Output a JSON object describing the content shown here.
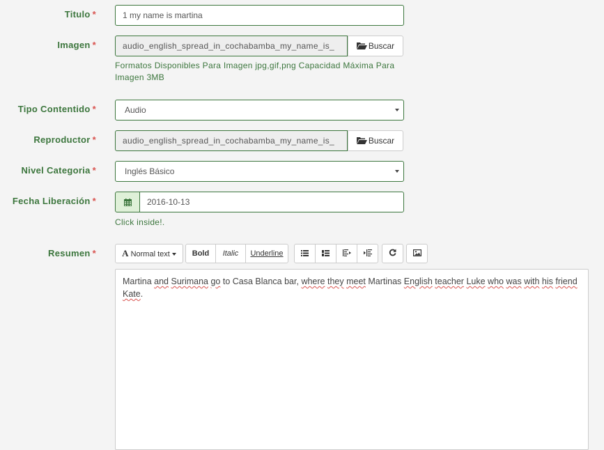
{
  "form": {
    "required_mark": "*",
    "titulo": {
      "label": "Titulo",
      "value": "1 my name is martina"
    },
    "imagen": {
      "label": "Imagen",
      "value": "audio_english_spread_in_cochabamba_my_name_is_",
      "button": "Buscar",
      "help_line1": "Formatos Disponibles Para Imagen jpg,gif,png Capacidad Máxima Para",
      "help_line2": "Imagen 3MB"
    },
    "tipo_contenido": {
      "label": "Tipo Contentido",
      "value": "Audio"
    },
    "reproductor": {
      "label": "Reproductor",
      "value": "audio_english_spread_in_cochabamba_my_name_is_",
      "button": "Buscar"
    },
    "nivel_categoria": {
      "label": "Nivel Categoria",
      "value": "Inglés Básico"
    },
    "fecha_liberacion": {
      "label": "Fecha Liberación",
      "value": "2016-10-13",
      "help": "Click inside!."
    },
    "resumen": {
      "label": "Resumen",
      "toolbar": {
        "text_style": "Normal text",
        "bold": "Bold",
        "italic": "Italic",
        "underline": "Underline"
      },
      "content_words": [
        {
          "t": "Martina ",
          "s": false
        },
        {
          "t": "and",
          "s": true
        },
        {
          "t": " ",
          "s": false
        },
        {
          "t": "Surimana",
          "s": true
        },
        {
          "t": " ",
          "s": false
        },
        {
          "t": "go",
          "s": true
        },
        {
          "t": " to Casa Blanca bar, ",
          "s": false
        },
        {
          "t": "where",
          "s": true
        },
        {
          "t": " ",
          "s": false
        },
        {
          "t": "they",
          "s": true
        },
        {
          "t": " ",
          "s": false
        },
        {
          "t": "meet",
          "s": true
        },
        {
          "t": " Martinas ",
          "s": false
        },
        {
          "t": "English",
          "s": true
        },
        {
          "t": " ",
          "s": false
        },
        {
          "t": "teacher",
          "s": true
        },
        {
          "t": " ",
          "s": false
        },
        {
          "t": "Luke",
          "s": true
        },
        {
          "t": " ",
          "s": false
        },
        {
          "t": "who",
          "s": true
        },
        {
          "t": " ",
          "s": false
        },
        {
          "t": "was",
          "s": true
        },
        {
          "t": " ",
          "s": false
        },
        {
          "t": "with",
          "s": true
        },
        {
          "t": " ",
          "s": false
        },
        {
          "t": "his",
          "s": true
        },
        {
          "t": " ",
          "s": false
        },
        {
          "t": "friend",
          "s": true
        },
        {
          "t": " ",
          "s": false
        },
        {
          "t": "Kate",
          "s": true
        },
        {
          "t": ".",
          "s": false
        }
      ]
    }
  },
  "colors": {
    "label_green": "#3c763d",
    "required_red": "#d9534f",
    "addon_bg": "#dff0d8"
  },
  "icons": {
    "folder": "folder-open-icon",
    "calendar": "calendar-icon",
    "caret": "caret-down-icon"
  }
}
